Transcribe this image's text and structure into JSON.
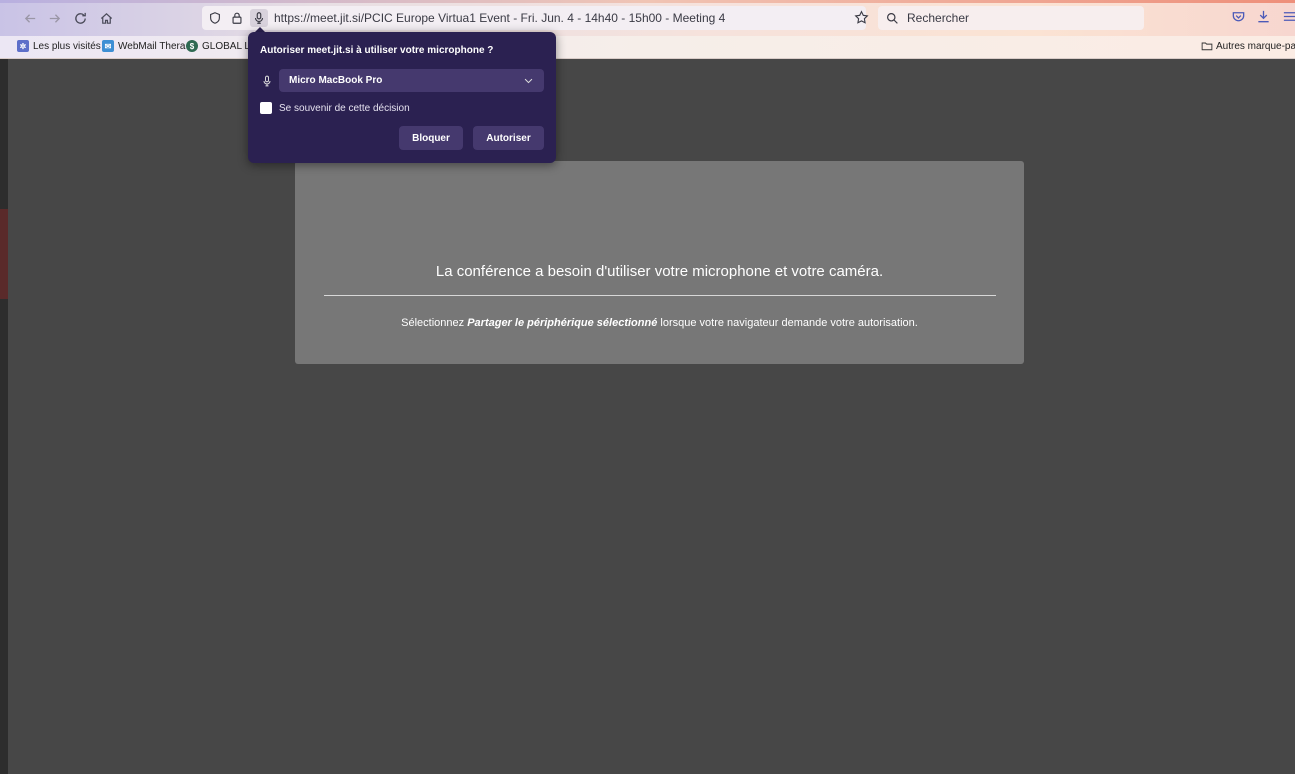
{
  "browser": {
    "url_domain": "https://meet.jit.si/",
    "url_path": "PCIC Europe Virtua1 Event - Fri. Jun. 4 - 14h40 - 15h00 - Meeting 4",
    "search_placeholder": "Rechercher"
  },
  "bookmarks": {
    "items": [
      {
        "label": "Les plus visités",
        "icon": "gear-icon"
      },
      {
        "label": "WebMail Thera",
        "icon": "mail-icon"
      },
      {
        "label": "GLOBAL LI",
        "icon": "globe-icon"
      }
    ],
    "other_label": "Autres marque-page"
  },
  "permission_popup": {
    "title": "Autoriser meet.jit.si à utiliser votre microphone ?",
    "device_selected": "Micro MacBook Pro",
    "remember_label": "Se souvenir de cette décision",
    "block_label": "Bloquer",
    "allow_label": "Autoriser"
  },
  "page": {
    "title": "La conférence a besoin d'utiliser votre microphone et votre caméra.",
    "sub_prefix": "Sélectionnez ",
    "sub_emphasis": "Partager le périphérique sélectionné",
    "sub_suffix": " lorsque votre navigateur demande votre autorisation."
  },
  "colors": {
    "page_bg": "#474747",
    "card_bg": "#777777",
    "popup_bg": "#2b2151",
    "popup_control": "#45396e"
  }
}
